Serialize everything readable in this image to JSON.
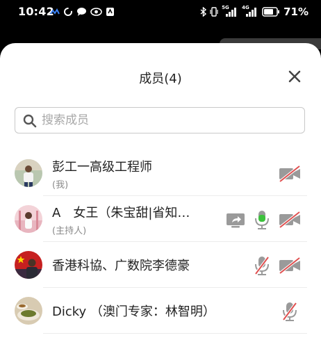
{
  "status_bar": {
    "time": "10:42",
    "network_1": "5G",
    "network_2": "4G",
    "battery_percent": "71%"
  },
  "sheet": {
    "title": "成员(4)",
    "search_placeholder": "搜索成员"
  },
  "members": [
    {
      "name": "彭工一高级工程师",
      "role": "(我)",
      "icons": [
        "video-off-icon"
      ]
    },
    {
      "name": "A　女王（朱宝甜|省知…",
      "role": "(主持人)",
      "icons": [
        "screen-share-icon",
        "mic-active-icon",
        "video-off-icon"
      ]
    },
    {
      "name": "香港科協、广数院李德豪",
      "role": "",
      "icons": [
        "mic-off-icon",
        "video-off-icon"
      ]
    },
    {
      "name": "Dicky （澳门专家：林智明）",
      "role": "",
      "icons": [
        "mic-off-icon"
      ]
    }
  ],
  "colors": {
    "mic_active": "#3cc23c",
    "icon_gray": "#9a9a9a",
    "off_slash": "#e05050"
  }
}
